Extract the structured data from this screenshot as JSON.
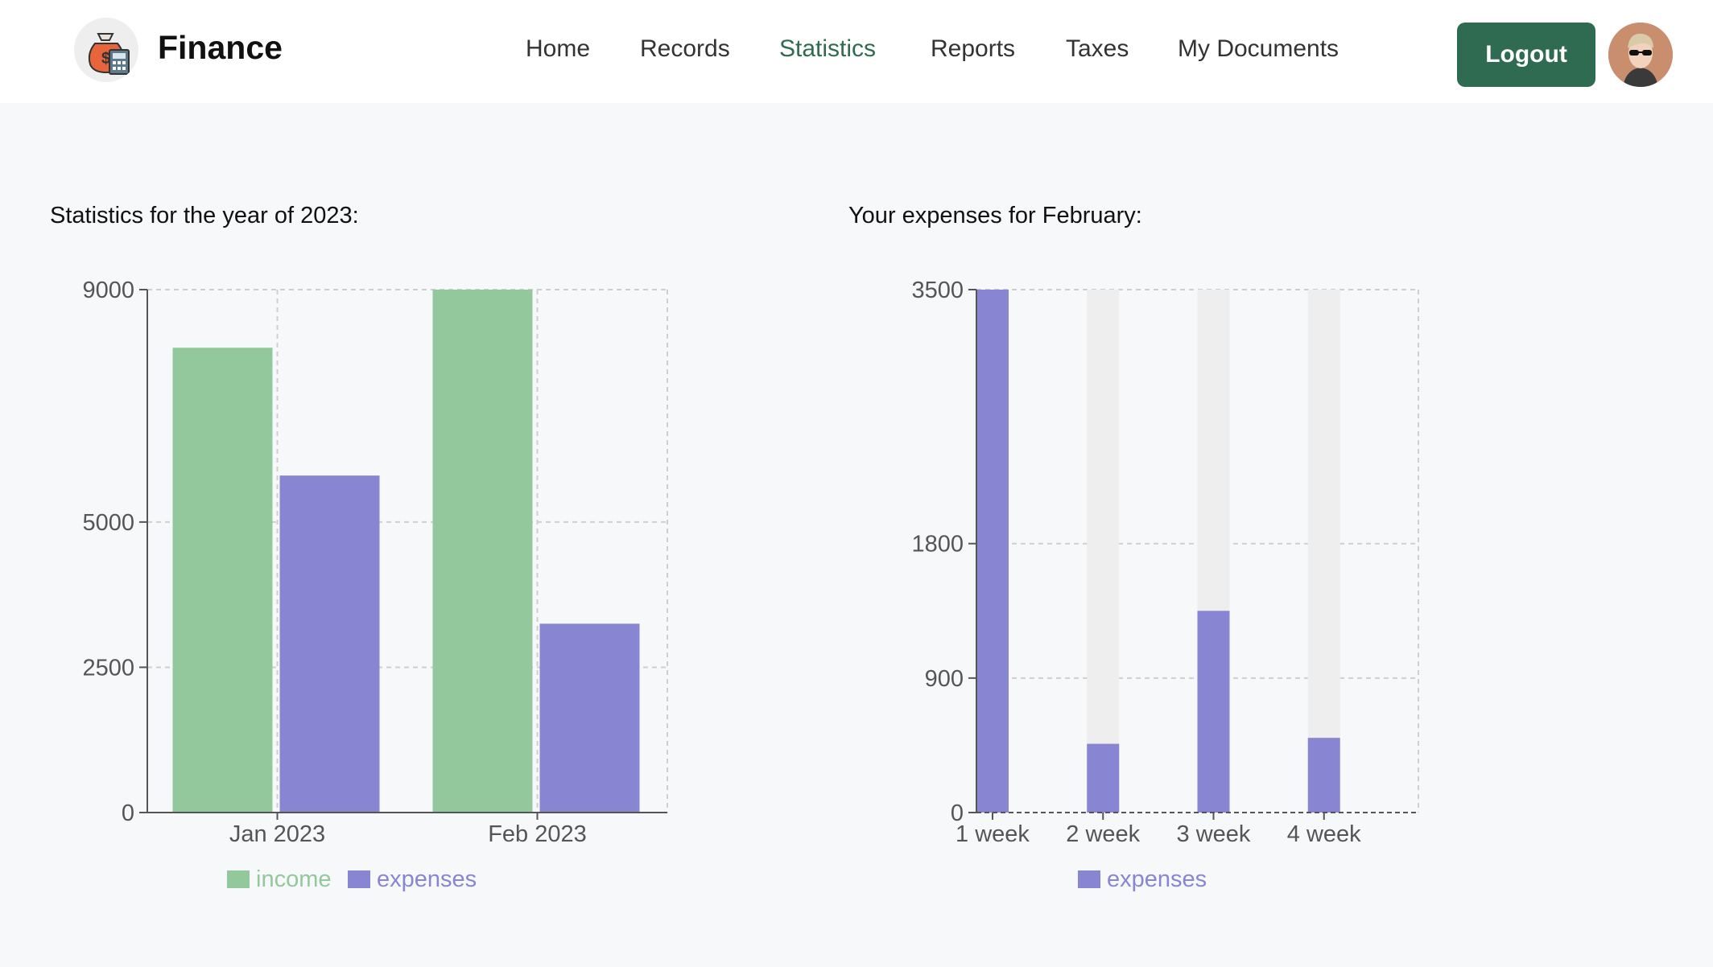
{
  "app": {
    "title": "Finance"
  },
  "nav": {
    "items": [
      {
        "label": "Home",
        "active": false
      },
      {
        "label": "Records",
        "active": false
      },
      {
        "label": "Statistics",
        "active": true
      },
      {
        "label": "Reports",
        "active": false
      },
      {
        "label": "Taxes",
        "active": false
      },
      {
        "label": "My Documents",
        "active": false
      }
    ]
  },
  "header": {
    "logout_label": "Logout",
    "logo_icon": "money-bag-calculator-icon",
    "avatar_icon": "user-avatar-sunglasses"
  },
  "colors": {
    "accent": "#2e6b50",
    "income": "#93c89d",
    "expenses": "#8886d2",
    "bar_background": "#eeeeee"
  },
  "sections": {
    "yearly_title": "Statistics for the year of 2023:",
    "monthly_title": "Your expenses for February:"
  },
  "chart_data": [
    {
      "type": "bar",
      "title": "Statistics for the year of 2023:",
      "categories": [
        "Jan 2023",
        "Feb 2023"
      ],
      "series": [
        {
          "name": "income",
          "values": [
            8000,
            9000
          ],
          "color": "#93c89d"
        },
        {
          "name": "expenses",
          "values": [
            5800,
            3250
          ],
          "color": "#8886d2"
        }
      ],
      "y_ticks": [
        0,
        2500,
        5000,
        9000
      ],
      "ylim": [
        0,
        9000
      ],
      "grid": true,
      "legend": "bottom"
    },
    {
      "type": "bar",
      "title": "Your expenses for February:",
      "categories": [
        "1 week",
        "2 week",
        "3 week",
        "4 week"
      ],
      "series": [
        {
          "name": "expenses",
          "values": [
            3500,
            460,
            1350,
            500
          ],
          "color": "#8886d2"
        }
      ],
      "y_ticks": [
        0,
        900,
        1800,
        3500
      ],
      "ylim": [
        0,
        3500
      ],
      "grid": true,
      "background_bars": true,
      "legend": "bottom"
    }
  ]
}
